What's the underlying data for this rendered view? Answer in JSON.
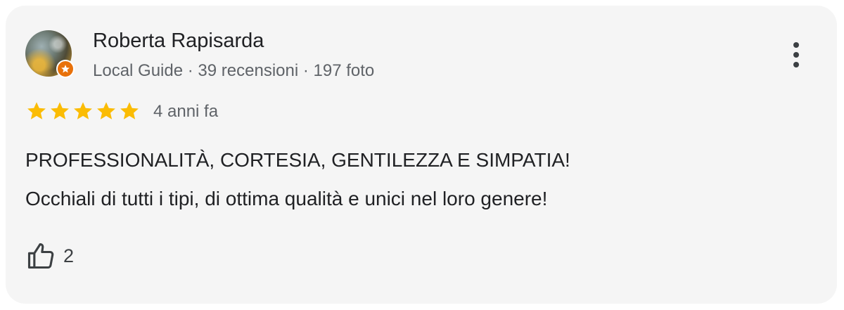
{
  "review": {
    "author": "Roberta Rapisarda",
    "meta": "Local Guide · 39 recensioni · 197 foto",
    "rating": 5,
    "max_rating": 5,
    "time_ago": "4 anni fa",
    "text_line1": "PROFESSIONALITÀ, CORTESIA, GENTILEZZA E SIMPATIA!",
    "text_line2": "Occhiali di tutti i tipi, di ottima qualità e unici nel loro genere!",
    "likes": "2"
  },
  "icons": {
    "avatar": "user-avatar",
    "badge": "local-guide-badge-icon",
    "more": "more-vert-icon",
    "star": "star-icon",
    "like": "thumbs-up-icon"
  },
  "colors": {
    "card_bg": "#f5f5f5",
    "star": "#fbbc04",
    "text": "#202124",
    "secondary_text": "#5f6368",
    "badge": "#e8710a"
  }
}
